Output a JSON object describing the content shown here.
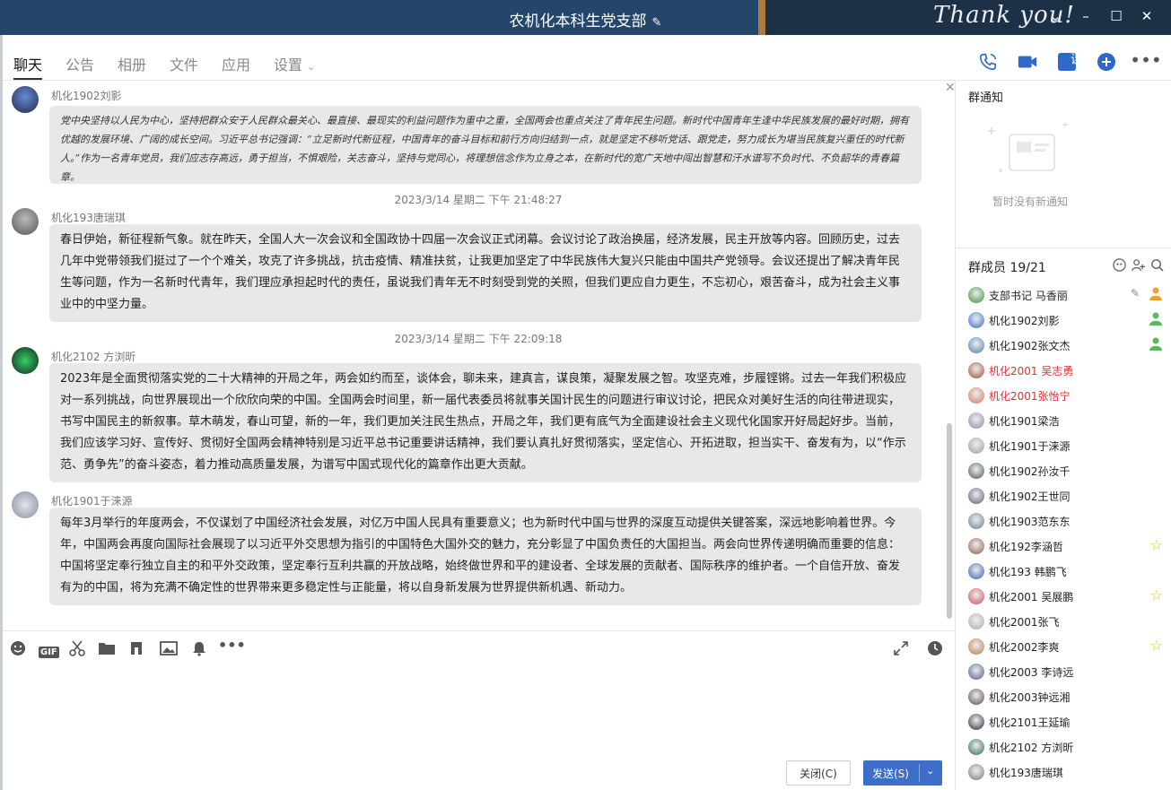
{
  "window": {
    "title": "农机化本科生党支部"
  },
  "tabs": [
    {
      "label": "聊天"
    },
    {
      "label": "公告"
    },
    {
      "label": "相册"
    },
    {
      "label": "文件"
    },
    {
      "label": "应用"
    },
    {
      "label": "设置"
    }
  ],
  "top_icons": [
    "phone-icon",
    "video-icon",
    "class-icon",
    "add-icon",
    "more-icon"
  ],
  "class_icon_label": "课",
  "chat": {
    "messages": [
      {
        "sender": "机化1902刘影",
        "text": "党中央坚持以人民为中心，坚持把群众安于人民群众最关心、最直接、最现实的利益问题作为重中之重，全国两会也重点关注了青年民生问题。新时代中国青年生逢中华民族发展的最好时期，拥有优越的发展环境、广阔的成长空间。习近平总书记强调：“立足新时代新征程，中国青年的奋斗目标和前行方向归结到一点，就是坚定不移听党话、跟党走，努力成长为堪当民族复兴重任的时代新人。”作为一名青年党员，我们应志存高远，勇于担当，不惧艰险，关志奋斗，坚持与党同心，将理想信念作为立身之本，在新时代的宽广天地中闯出智慧和汗水谱写不负时代、不负韶华的青春篇章。"
      },
      {
        "timestamp": "2023/3/14 星期二 下午 21:48:27",
        "sender": "机化193唐瑞琪",
        "text": "春日伊始，新征程新气象。就在昨天，全国人大一次会议和全国政协十四届一次会议正式闭幕。会议讨论了政治换届，经济发展，民主开放等内容。回顾历史，过去几年中党带领我们挺过了一个个难关，攻克了许多挑战，抗击疫情、精准扶贫，让我更加坚定了中华民族伟大复兴只能由中国共产党领导。会议还提出了解决青年民生等问题，作为一名新时代青年，我们理应承担起时代的责任，虽说我们青年无不时刻受到党的关照，但我们更应自力更生，不忘初心，艰苦奋斗，成为社会主义事业中的中坚力量。"
      },
      {
        "timestamp": "2023/3/14 星期二 下午 22:09:18",
        "sender": "机化2102 方浏昕",
        "text": "2023年是全面贯彻落实党的二十大精神的开局之年，两会如约而至，谈体会，聊未来，建真言，谋良策，凝聚发展之智。攻坚克难，步履铿锵。过去一年我们积极应对一系列挑战，向世界展现出一个欣欣向荣的中国。全国两会时间里，新一届代表委员将就事关国计民生的问题进行审议讨论，把民众对美好生活的向往带进现实，书写中国民主的新叙事。草木萌发，春山可望，新的一年，我们更加关注民生热点，开局之年，我们更有底气为全面建设社会主义现代化国家开好局起好步。当前，我们应该学习好、宣传好、贯彻好全国两会精神特别是习近平总书记重要讲话精神，我们要认真扎好贯彻落实，坚定信心、开拓进取，担当实干、奋发有为，以“作示范、勇争先”的奋斗姿态，着力推动高质量发展，为谱写中国式现代化的篇章作出更大贡献。"
      },
      {
        "sender": "机化1901于涞源",
        "text": "每年3月举行的年度两会，不仅谋划了中国经济社会发展，对亿万中国人民具有重要意义；也为新时代中国与世界的深度互动提供关键答案，深远地影响着世界。今年，中国两会再度向国际社会展现了以习近平外交思想为指引的中国特色大国外交的魅力，充分彰显了中国负责任的大国担当。两会向世界传递明确而重要的信息：中国将坚定奉行独立自主的和平外交政策，坚定奉行互利共赢的开放战略，始终做世界和平的建设者、全球发展的贡献者、国际秩序的维护者。一个自信开放、奋发有为的中国，将为充满不确定性的世界带来更多稳定性与正能量，将以自身新发展为世界提供新机遇、新动力。"
      }
    ]
  },
  "toolbar": {
    "tools": [
      "emoji-icon",
      "gif-icon",
      "scissors-icon",
      "folder-icon",
      "music-icon",
      "image-icon",
      "bell-icon",
      "more-icon"
    ],
    "gif_label": "GIF"
  },
  "input": {
    "value": ""
  },
  "buttons": {
    "close_label": "关闭(C)",
    "send_label": "发送(S)"
  },
  "group_notice": {
    "title": "群通知",
    "empty_text": "暂时没有新通知"
  },
  "members": {
    "title": "群成员 19/21",
    "list": [
      {
        "name": "支部书记 马香丽",
        "role": "owner",
        "color": "#3a8a3a",
        "red": false
      },
      {
        "name": "机化1902刘影",
        "role": "admin",
        "color": "#3a6ac8",
        "red": false
      },
      {
        "name": "机化1902张文杰",
        "role": "admin",
        "color": "#4a7aa8",
        "red": false
      },
      {
        "name": "机化2001 吴志勇",
        "role": "",
        "color": "#a04a3a",
        "red": true
      },
      {
        "name": "机化2001张怡宁",
        "role": "",
        "color": "#c87a5a",
        "red": true
      },
      {
        "name": "机化1901梁浩",
        "role": "",
        "color": "#8a8aa0",
        "red": false
      },
      {
        "name": "机化1901于涞源",
        "role": "",
        "color": "#9a9aaa",
        "red": false
      },
      {
        "name": "机化1902孙汝千",
        "role": "",
        "color": "#4a5a4a",
        "red": false
      },
      {
        "name": "机化1902王世同",
        "role": "",
        "color": "#5a5a7a",
        "red": false
      },
      {
        "name": "机化1903范东东",
        "role": "",
        "color": "#6a7a8a",
        "red": false
      },
      {
        "name": "机化192李涵哲",
        "role": "star",
        "color": "#8a5a4a",
        "red": false
      },
      {
        "name": "机化193 韩鹏飞",
        "role": "",
        "color": "#3a5aaa",
        "red": false
      },
      {
        "name": "机化2001 吴展鹏",
        "role": "star",
        "color": "#c84a5a",
        "red": false
      },
      {
        "name": "机化2001张飞",
        "role": "",
        "color": "#aaaab8",
        "red": false
      },
      {
        "name": "机化2002李爽",
        "role": "star",
        "color": "#b87a4a",
        "red": false
      },
      {
        "name": "机化2003 李诗远",
        "role": "",
        "color": "#4a5a8a",
        "red": false
      },
      {
        "name": "机化2003钟远湘",
        "role": "",
        "color": "#5a4a4a",
        "red": false
      },
      {
        "name": "机化2101王延瑜",
        "role": "",
        "color": "#2a2a3a",
        "red": false
      },
      {
        "name": "机化2102 方浏昕",
        "role": "",
        "color": "#2a6a4a",
        "red": false
      },
      {
        "name": "机化193唐瑞琪",
        "role": "",
        "color": "#7a7a7a",
        "red": false
      }
    ]
  }
}
